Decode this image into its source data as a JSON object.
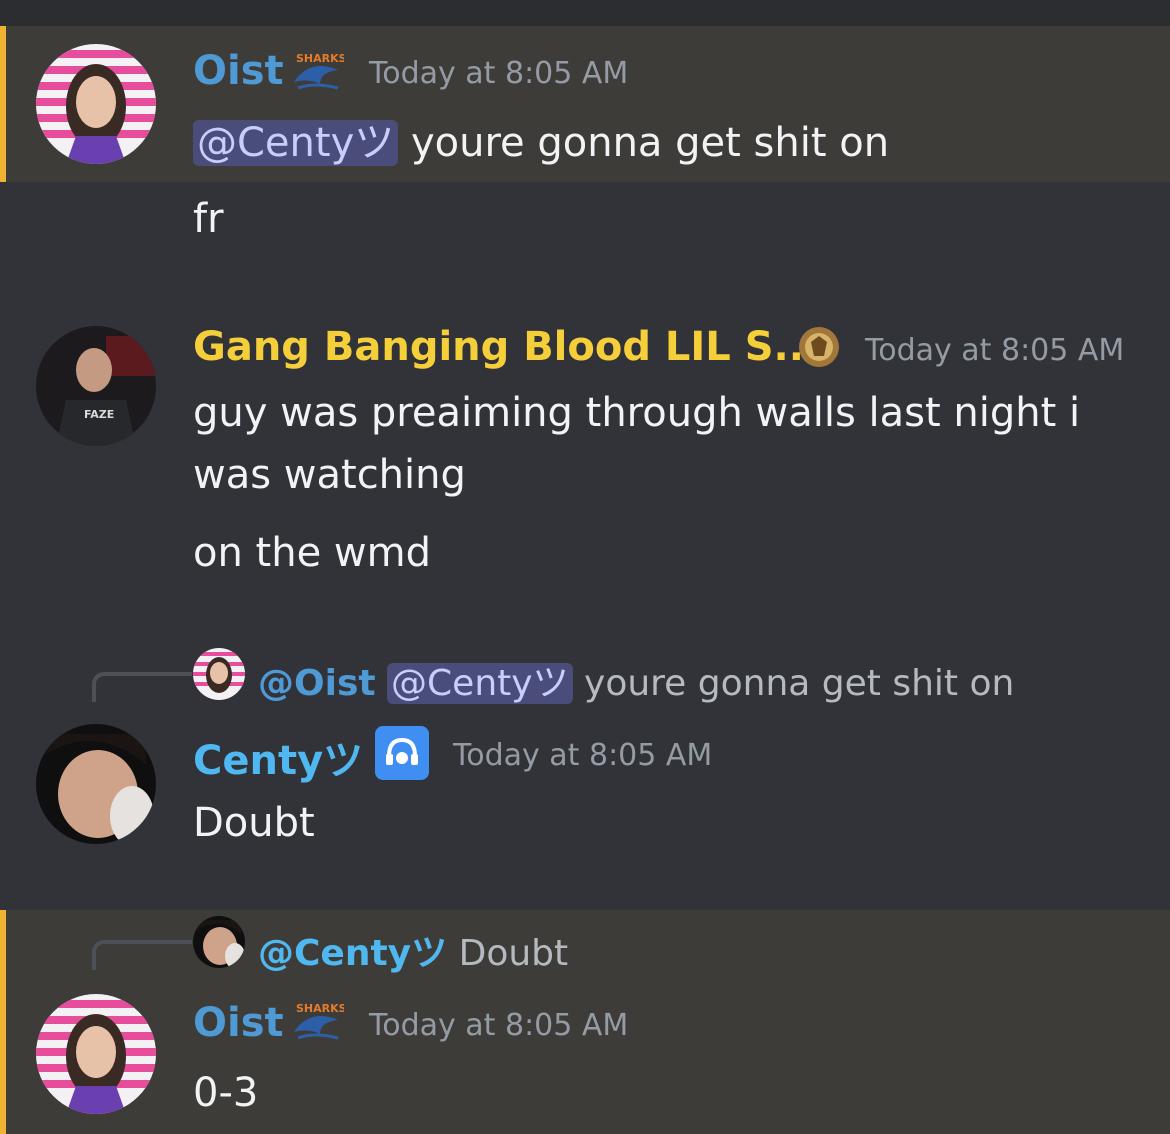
{
  "messages": [
    {
      "author": "Oist",
      "author_color": "#4f9ad4",
      "timestamp": "Today at 8:05 AM",
      "mention": "@Centyツ",
      "text": " youre gonna get shit on",
      "followup": "fr",
      "badge_icon": "sharks-logo-icon"
    },
    {
      "author": "Gang Banging Blood LIL S...",
      "author_color": "#f5cf3a",
      "timestamp": "Today at 8:05 AM",
      "text": "guy was preaiming through walls last night i was watching",
      "followup": "on the wmd",
      "badge_icon": "golden-crest-icon"
    },
    {
      "reply": {
        "author": "@Oist",
        "mention": "@Centyツ",
        "text": " youre gonna get shit on"
      },
      "author": "Centyツ",
      "author_color": "#4fb8f0",
      "timestamp": "Today at 8:05 AM",
      "text": "Doubt",
      "badge_icon": "headset-icon"
    },
    {
      "reply": {
        "author": "@Centyツ",
        "text": "Doubt"
      },
      "author": "Oist",
      "author_color": "#4f9ad4",
      "timestamp": "Today at 8:05 AM",
      "text": "0-3",
      "badge_icon": "sharks-logo-icon"
    }
  ],
  "colors": {
    "background": "#313338",
    "mention_highlight": "#3e3c39",
    "mention_bar": "#f0b232"
  }
}
